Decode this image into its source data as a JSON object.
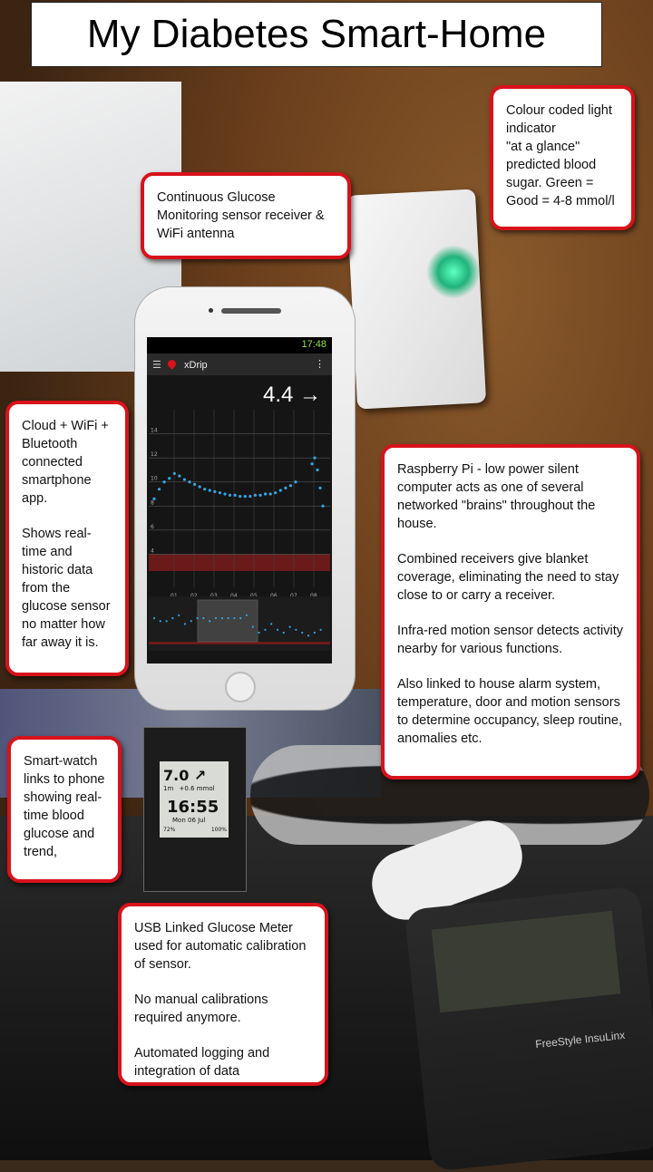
{
  "title": "My Diabetes Smart-Home",
  "callouts": {
    "colour_indicator": [
      "Colour coded light indicator",
      "\"at a glance\" predicted blood sugar. Green = Good = 4-8 mmol/l"
    ],
    "cgm_receiver": "Continuous Glucose Monitoring sensor receiver & WiFi antenna",
    "cloud_app": [
      "Cloud + WiFi + Bluetooth connected smartphone app.",
      "Shows real-time and historic data from the glucose sensor no matter how far away it is."
    ],
    "raspberry_pi": [
      "Raspberry Pi - low power silent computer acts as one of several networked \"brains\" throughout the house.",
      "Combined receivers give blanket coverage, eliminating the need to stay close to or carry a receiver.",
      "Infra-red motion sensor detects activity nearby for various functions.",
      "Also linked to house alarm system, temperature, door and motion sensors to determine occupancy, sleep routine, anomalies etc."
    ],
    "smartwatch": "Smart-watch links to phone showing real-time blood glucose and trend,",
    "usb_meter": [
      "USB Linked Glucose Meter used for automatic calibration of sensor.",
      "No manual calibrations required anymore.",
      "Automated logging and integration of data"
    ]
  },
  "phone": {
    "status_time": "17:48",
    "app_name": "xDrip",
    "reading": "4.4 →",
    "y_ticks": [
      "14",
      "12",
      "10",
      "8",
      "6",
      "4"
    ],
    "x_ticks": [
      "01",
      "02",
      "03",
      "04",
      "05",
      "06",
      "07",
      "08"
    ],
    "glucose_trace": [
      8.6,
      9.4,
      10.0,
      10.3,
      10.7,
      10.5,
      10.2,
      10.0,
      9.8,
      9.6,
      9.4,
      9.3,
      9.2,
      9.1,
      9.0,
      8.9,
      8.9,
      8.8,
      8.8,
      8.8,
      8.9,
      8.9,
      9.0,
      9.0,
      9.1,
      9.3,
      9.5,
      9.7,
      10.0
    ],
    "late_spike": [
      11.5,
      12.0,
      11.0,
      9.5,
      8.0
    ]
  },
  "watch": {
    "glucose": "7.0 ↗",
    "delta": "+0.6 mmol",
    "ago": "1m",
    "time": "16:55",
    "date": "Mon 06 Jul",
    "battery_left": "72%",
    "battery_right": "100%"
  },
  "meter": {
    "brand": "FreeStyle InsuLinx"
  },
  "colors": {
    "callout_border": "#d8121b",
    "indicator_green": "#20b37a",
    "trace": "#35a7e6",
    "low_band": "#6b1a1a"
  }
}
